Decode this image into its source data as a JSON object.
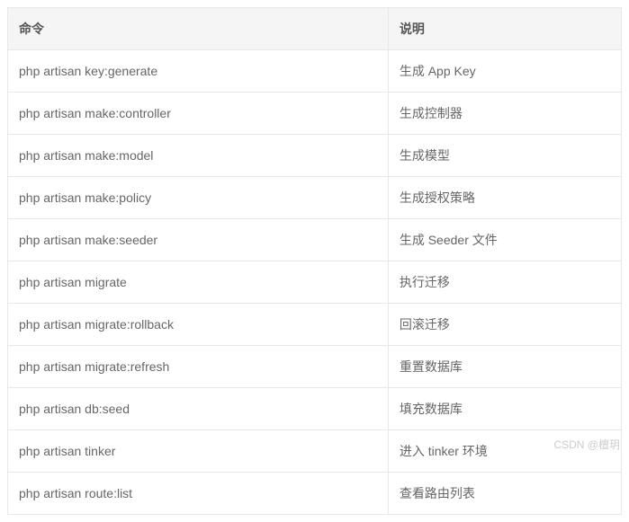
{
  "table": {
    "headers": {
      "command": "命令",
      "description": "说明"
    },
    "rows": [
      {
        "command": "php artisan key:generate",
        "description": "生成 App Key"
      },
      {
        "command": "php artisan make:controller",
        "description": "生成控制器"
      },
      {
        "command": "php artisan make:model",
        "description": "生成模型"
      },
      {
        "command": "php artisan make:policy",
        "description": "生成授权策略"
      },
      {
        "command": "php artisan make:seeder",
        "description": "生成 Seeder 文件"
      },
      {
        "command": "php artisan migrate",
        "description": "执行迁移"
      },
      {
        "command": "php artisan migrate:rollback",
        "description": "回滚迁移"
      },
      {
        "command": "php artisan migrate:refresh",
        "description": "重置数据库"
      },
      {
        "command": "php artisan db:seed",
        "description": "填充数据库"
      },
      {
        "command": "php artisan tinker",
        "description": "进入 tinker 环境"
      },
      {
        "command": "php artisan route:list",
        "description": "查看路由列表"
      }
    ]
  },
  "watermark": "CSDN @檀玥"
}
